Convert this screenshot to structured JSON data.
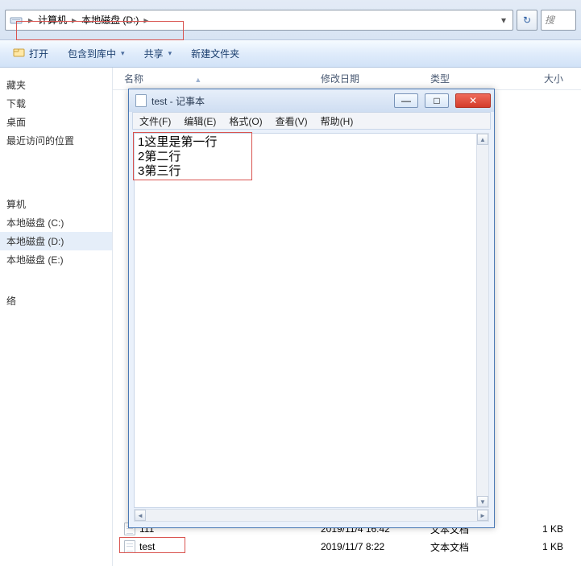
{
  "breadcrumb": {
    "seg1": "计算机",
    "seg2": "本地磁盘 (D:)"
  },
  "addr_dropdown_glyph": "▾",
  "refresh_glyph": "↻",
  "search": {
    "placeholder": "搜"
  },
  "toolbar": {
    "open": "打开",
    "include": "包含到库中",
    "share": "共享",
    "newfolder": "新建文件夹"
  },
  "nav": {
    "fav": "藏夹",
    "downloads": "下载",
    "desktop": "桌面",
    "recent": "最近访问的位置",
    "computer": "算机",
    "cdrive": "本地磁盘 (C:)",
    "ddrive": "本地磁盘 (D:)",
    "edrive": "本地磁盘 (E:)",
    "network": "络"
  },
  "columns": {
    "name": "名称",
    "modified": "修改日期",
    "type": "类型",
    "size": "大小",
    "sort_glyph": "▲"
  },
  "files": [
    {
      "name": "111",
      "modified": "2019/11/4 16:42",
      "type": "文本文档",
      "size": "1 KB"
    },
    {
      "name": "test",
      "modified": "2019/11/7 8:22",
      "type": "文本文档",
      "size": "1 KB"
    }
  ],
  "notepad": {
    "title": "test - 记事本",
    "menu": {
      "file": "文件(F)",
      "edit": "编辑(E)",
      "format": "格式(O)",
      "view": "查看(V)",
      "help": "帮助(H)"
    },
    "btn_min": "—",
    "btn_max": "□",
    "btn_close": "✕",
    "content": "1这里是第一行\n2第二行\n3第三行",
    "scroll_left": "◄",
    "scroll_right": "►",
    "scroll_up": "▲",
    "scroll_down": "▼"
  }
}
